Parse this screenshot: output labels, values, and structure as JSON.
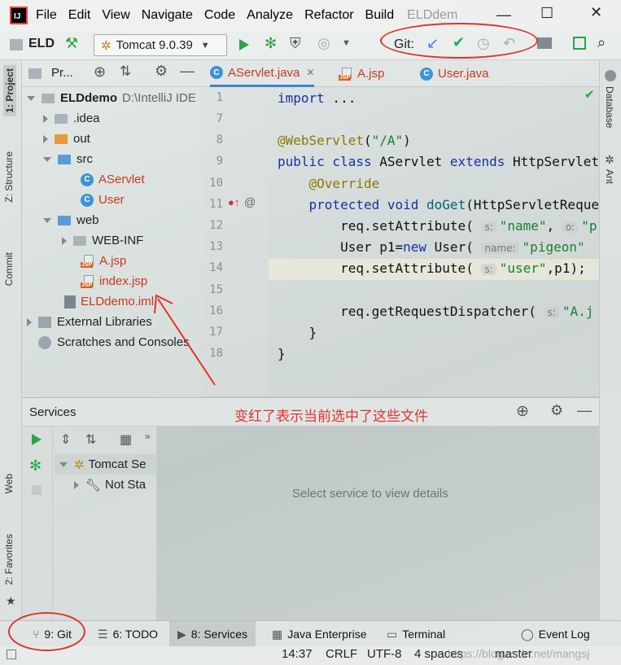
{
  "menubar": {
    "items": [
      "File",
      "Edit",
      "View",
      "Navigate",
      "Code",
      "Analyze",
      "Refactor",
      "Build"
    ],
    "project_title": "ELDdem"
  },
  "toolbar": {
    "project_name": "ELD",
    "run_config": "Tomcat 9.0.39",
    "git_label": "Git:"
  },
  "left_strip": {
    "project_tab": "1: Project",
    "structure_tab": "Z: Structure",
    "commit_tab": "Commit",
    "web_tab": "Web",
    "favorites_tab": "2: Favorites"
  },
  "right_strip": {
    "database_tab": "Database",
    "ant_tab": "Ant"
  },
  "project_panel": {
    "header": "Pr...",
    "tree": [
      {
        "label": "ELDdemo",
        "extra": "D:\\IntelliJ IDE"
      },
      {
        "label": ".idea"
      },
      {
        "label": "out"
      },
      {
        "label": "src"
      },
      {
        "label": "AServlet"
      },
      {
        "label": "User"
      },
      {
        "label": "web"
      },
      {
        "label": "WEB-INF"
      },
      {
        "label": "A.jsp"
      },
      {
        "label": "index.jsp"
      },
      {
        "label": "ELDdemo.iml"
      },
      {
        "label": "External Libraries"
      },
      {
        "label": "Scratches and Consoles"
      }
    ]
  },
  "editor": {
    "tabs": [
      "AServlet.java",
      "A.jsp",
      "User.java"
    ],
    "line_numbers": [
      "1",
      "7",
      "8",
      "9",
      "10",
      "11",
      "12",
      "13",
      "14",
      "15",
      "16",
      "17",
      "18"
    ]
  },
  "services": {
    "title": "Services",
    "tomcat_node": "Tomcat Se",
    "not_started": "Not Sta",
    "detail_placeholder": "Select service to view details"
  },
  "annotation": {
    "text": "变红了表示当前选中了这些文件"
  },
  "bottom_tabs": {
    "git": "9: Git",
    "todo": "6: TODO",
    "services": "8: Services",
    "java_enterprise": "Java Enterprise",
    "terminal": "Terminal",
    "event_log": "Event Log"
  },
  "statusbar": {
    "position": "14:37",
    "line_sep": "CRLF",
    "encoding": "UTF-8",
    "indent": "4 spaces",
    "branch": "master",
    "watermark": "https://blog.csdn.net/mangsj"
  },
  "colors": {
    "accent_blue": "#4083c9",
    "annotation_red": "#e0342b",
    "modified_red": "#c7381a",
    "run_green": "#2aa548"
  }
}
